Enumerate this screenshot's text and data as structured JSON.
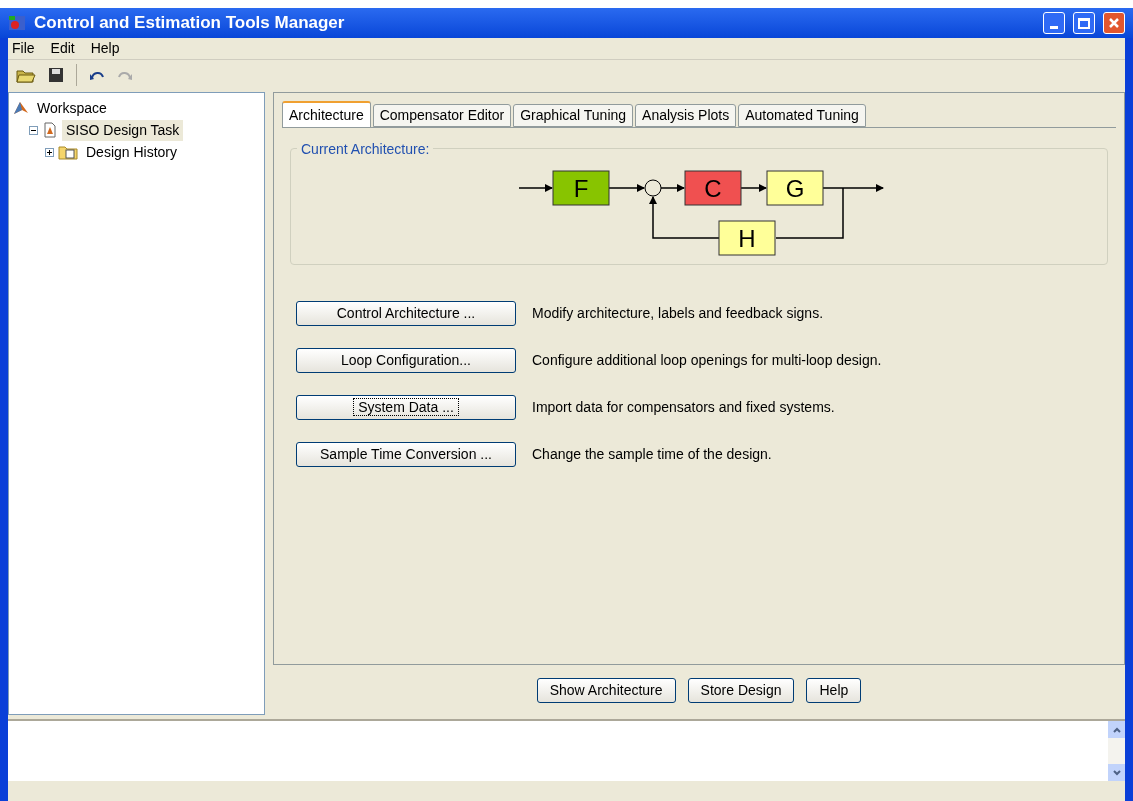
{
  "window": {
    "title": "Control and Estimation Tools Manager"
  },
  "menu": [
    {
      "label": "File"
    },
    {
      "label": "Edit"
    },
    {
      "label": "Help"
    }
  ],
  "tree": [
    {
      "label": "Workspace",
      "kind": "workspace",
      "selected": false,
      "children": [
        {
          "label": "SISO Design Task",
          "kind": "task",
          "selected": true,
          "expanded": true,
          "children": [
            {
              "label": "Design History",
              "kind": "folder",
              "selected": false,
              "expanded": false
            }
          ]
        }
      ]
    }
  ],
  "tabs": [
    {
      "label": "Architecture",
      "selected": true
    },
    {
      "label": "Compensator Editor",
      "selected": false
    },
    {
      "label": "Graphical Tuning",
      "selected": false
    },
    {
      "label": "Analysis Plots",
      "selected": false
    },
    {
      "label": "Automated Tuning",
      "selected": false
    }
  ],
  "architecture": {
    "title": "Current Architecture:",
    "blocks": [
      {
        "label": "F",
        "color": "#88c400"
      },
      {
        "label": "C",
        "color": "#f05050"
      },
      {
        "label": "G",
        "color": "#ffff99"
      },
      {
        "label": "H",
        "color": "#ffff99"
      }
    ]
  },
  "actions": [
    {
      "label": "Control Architecture ...",
      "description": "Modify architecture, labels and feedback signs.",
      "focused": false
    },
    {
      "label": "Loop Configuration...",
      "description": "Configure additional loop openings for multi-loop design.",
      "focused": false
    },
    {
      "label": "System Data ...",
      "description": "Import data for compensators and fixed systems.",
      "focused": true
    },
    {
      "label": "Sample Time Conversion ...",
      "description": "Change the sample time of the design.",
      "focused": false
    }
  ],
  "buttons": [
    {
      "label": "Show Architecture"
    },
    {
      "label": "Store Design"
    },
    {
      "label": "Help"
    }
  ]
}
